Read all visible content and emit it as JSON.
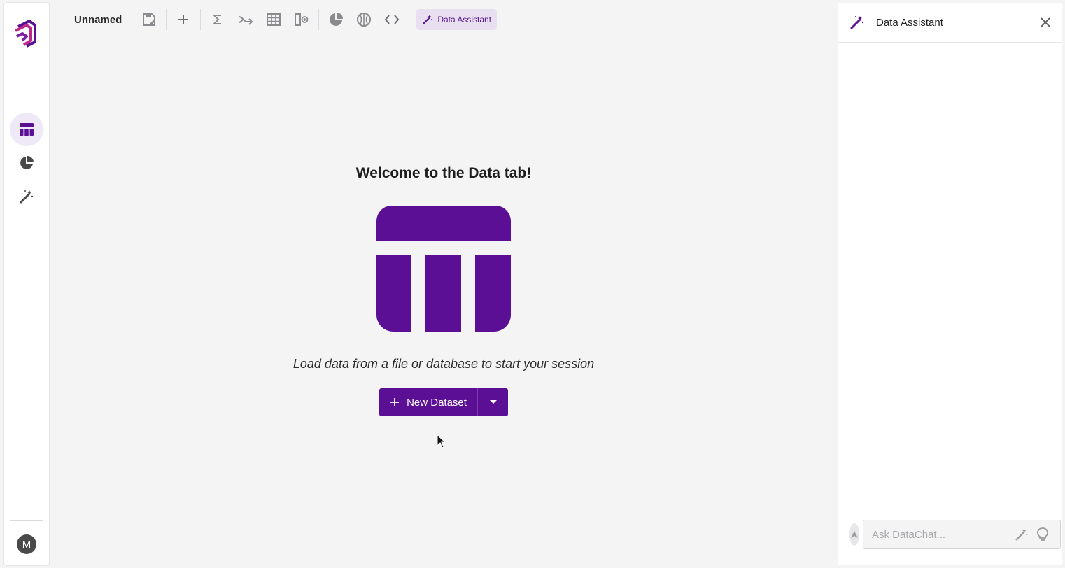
{
  "toolbar": {
    "title": "Unnamed",
    "assistant_label": "Data Assistant",
    "buttons": [
      "save-icon",
      "add-icon",
      "sigma-icon",
      "merge-icon",
      "table-icon",
      "column-add-icon",
      "pie-chart-icon",
      "model-icon",
      "code-icon"
    ]
  },
  "sidebar": {
    "items": [
      {
        "name": "data-tab",
        "icon": "table-icon",
        "active": true
      },
      {
        "name": "charts-tab",
        "icon": "pie-chart-icon",
        "active": false
      },
      {
        "name": "assistant-tab",
        "icon": "magic-wand-icon",
        "active": false
      }
    ],
    "avatar_letter": "M"
  },
  "welcome": {
    "heading": "Welcome to the Data tab!",
    "subtitle": "Load data from a file or database to start your session",
    "button_label": "New Dataset"
  },
  "panel": {
    "title": "Data Assistant",
    "input_placeholder": "Ask DataChat..."
  },
  "colors": {
    "accent": "#5b0f95",
    "accent_light": "#e8e0f0",
    "background": "#f4f4f5",
    "panel_bg": "#ffffff"
  }
}
